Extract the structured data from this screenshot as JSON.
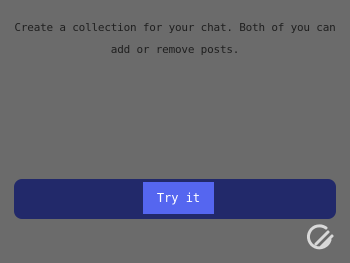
{
  "modal": {
    "description": "Create a collection for your chat. Both of you can add or remove posts.",
    "try_button_label": "Try it"
  },
  "colors": {
    "overlay": "#6b6b6b",
    "panel": "#22296a",
    "button": "#5566f0",
    "button_text": "#ffffff"
  },
  "icons": {
    "watermark": "app-logo-icon"
  }
}
